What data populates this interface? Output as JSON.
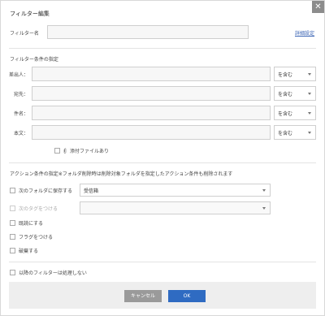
{
  "dialog": {
    "title": "フィルター編集",
    "close_glyph": "✕",
    "filter_name_label": "フィルター名",
    "filter_name_value": "",
    "detail_link": "詳細設定"
  },
  "conditions": {
    "heading": "フィルター条件の指定",
    "rows": [
      {
        "label": "差出人：",
        "value": "",
        "operator": "を含む"
      },
      {
        "label": "宛先：",
        "value": "",
        "operator": "を含む"
      },
      {
        "label": "件名：",
        "value": "",
        "operator": "を含む"
      },
      {
        "label": "本文：",
        "value": "",
        "operator": "を含む"
      }
    ],
    "attachment_label": "添付ファイルあり"
  },
  "actions": {
    "heading": "アクション条件の指定※フォルダ削除時は削除対象フォルダを指定したアクション条件も削除されます",
    "items": [
      {
        "label": "次のフォルダに保存する",
        "select_value": "受信箱",
        "disabled": false
      },
      {
        "label": "次のタグをつける",
        "select_value": "",
        "disabled": true
      },
      {
        "label": "既読にする"
      },
      {
        "label": "フラグをつける"
      },
      {
        "label": "破棄する"
      }
    ],
    "stop_label": "以降のフィルターは処理しない"
  },
  "footer": {
    "cancel_label": "キャンセル",
    "ok_label": "OK"
  },
  "colors": {
    "ok_button": "#2f6bc2",
    "cancel_button": "#9a9a9a",
    "link": "#3d66b5",
    "close_button": "#8c8c8c"
  }
}
